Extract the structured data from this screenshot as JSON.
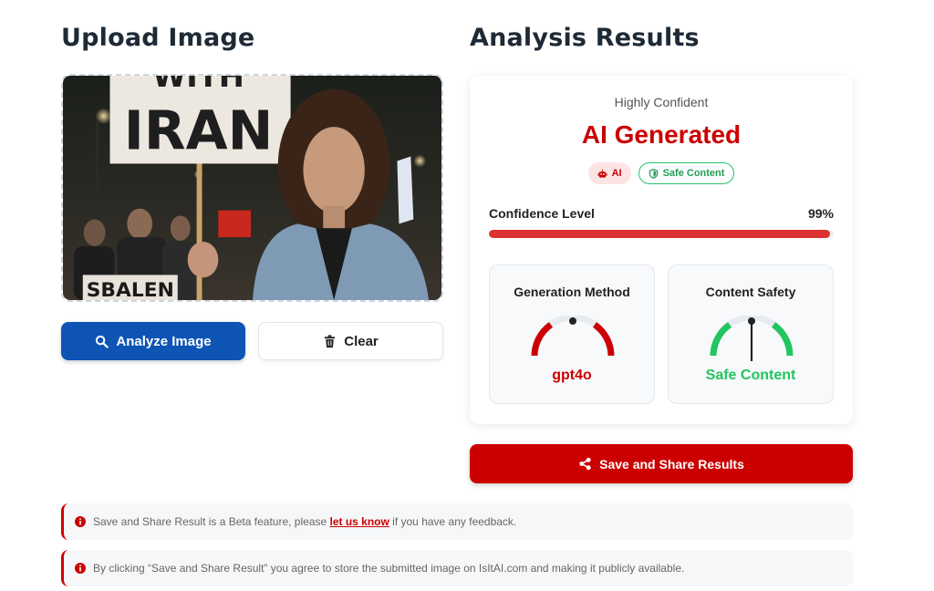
{
  "upload": {
    "title": "Upload Image",
    "sign_text": "WITH\nIRAN",
    "sign_line1": "WITH",
    "sign_line2": "IRAN",
    "lower_sign_text": "SBALEN",
    "analyze_label": "Analyze Image",
    "clear_label": "Clear"
  },
  "results": {
    "title": "Analysis Results",
    "confidence_label": "Highly Confident",
    "verdict": "AI Generated",
    "badges": [
      {
        "label": "AI",
        "icon": "robot-icon"
      },
      {
        "label": "Safe Content",
        "icon": "shield-icon"
      }
    ],
    "confidence": {
      "label": "Confidence Level",
      "value_text": "99%",
      "value": 0.99
    },
    "gauges": [
      {
        "title": "Generation Method",
        "value": "gpt4o",
        "color": "#cc0000"
      },
      {
        "title": "Content Safety",
        "value": "Safe Content",
        "color": "#22c55e"
      }
    ],
    "share_label": "Save and Share Results"
  },
  "notices": [
    {
      "before": "Save and Share Result is a Beta feature, please ",
      "link": "let us know",
      "after": " if you have any feedback."
    },
    {
      "text": "By clicking “Save and Share Result” you agree to store the submitted image on IsItAI.com and making it publicly available."
    }
  ],
  "colors": {
    "primary": "#0d54b5",
    "danger": "#cc0000",
    "safe": "#22c55e"
  }
}
